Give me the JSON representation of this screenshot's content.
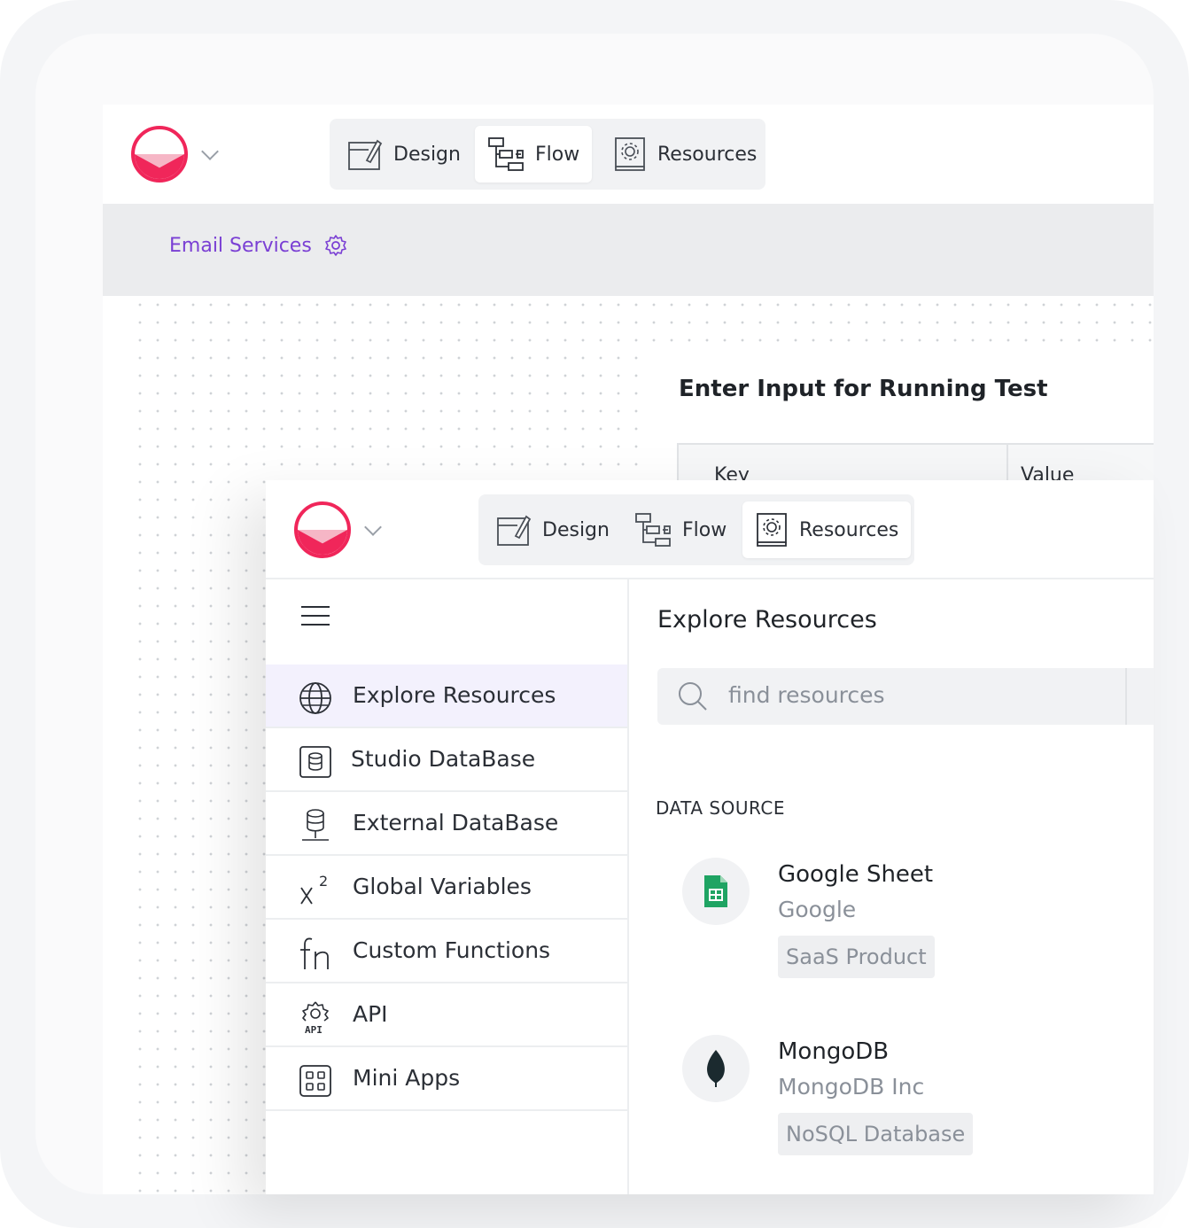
{
  "back_window": {
    "tabs": [
      {
        "label": "Design",
        "active": false
      },
      {
        "label": "Flow",
        "active": true
      },
      {
        "label": "Resources",
        "active": false
      }
    ],
    "service_title": "Email Services",
    "panel_title": "Enter Input for Running Test",
    "table_headers": [
      "Key",
      "Value"
    ]
  },
  "front_window": {
    "tabs": [
      {
        "label": "Design",
        "active": false
      },
      {
        "label": "Flow",
        "active": false
      },
      {
        "label": "Resources",
        "active": true
      }
    ],
    "sidebar": {
      "items": [
        {
          "label": "Explore Resources",
          "icon": "globe-icon",
          "active": true
        },
        {
          "label": "Studio DataBase",
          "icon": "database-icon",
          "active": false
        },
        {
          "label": "External DataBase",
          "icon": "external-database-icon",
          "active": false
        },
        {
          "label": "Global Variables",
          "icon": "variable-icon",
          "active": false
        },
        {
          "label": "Custom Functions",
          "icon": "function-icon",
          "active": false
        },
        {
          "label": "API",
          "icon": "api-gear-icon",
          "active": false
        },
        {
          "label": "Mini Apps",
          "icon": "grid-icon",
          "active": false
        }
      ]
    },
    "main": {
      "title": "Explore Resources",
      "search_placeholder": "find resources",
      "section_label": "DATA SOURCE",
      "resources": [
        {
          "name": "Google Sheet",
          "vendor": "Google",
          "tag": "SaaS Product",
          "icon": "google-sheets-icon"
        },
        {
          "name": "MongoDB",
          "vendor": "MongoDB Inc",
          "tag": "NoSQL Database",
          "icon": "mongodb-leaf-icon"
        }
      ]
    }
  },
  "colors": {
    "brand": "#f0265a",
    "accent_purple": "#7a3fd4",
    "sheets_green": "#1fa463",
    "mongo_dark": "#1b2a2f"
  }
}
